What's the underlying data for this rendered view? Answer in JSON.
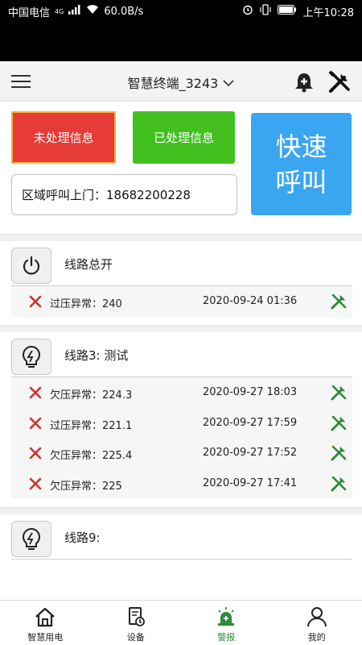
{
  "status_bar": {
    "carrier": "中国电信",
    "network": "4G",
    "speed": "60.0B/s",
    "battery": "100",
    "time": "上午10:28"
  },
  "header": {
    "title": "智慧终端_3243"
  },
  "actions": {
    "unhandled_label": "未处理信息",
    "handled_label": "已处理信息",
    "quick_call_line1": "快速",
    "quick_call_line2": "呼叫",
    "zone_call": "区域呼叫上门：18682200228"
  },
  "sections": [
    {
      "name": "线路总开",
      "icon": "power-icon",
      "rows": [
        {
          "msg": "过压异常：240",
          "time": "2020-09-24 01:36"
        }
      ]
    },
    {
      "name": "线路3: 测试",
      "icon": "bulb-icon",
      "rows": [
        {
          "msg": "欠压异常：224.3",
          "time": "2020-09-27 18:03"
        },
        {
          "msg": "过压异常：221.1",
          "time": "2020-09-27 17:59"
        },
        {
          "msg": "欠压异常：225.4",
          "time": "2020-09-27 17:52"
        },
        {
          "msg": "欠压异常：225",
          "time": "2020-09-27 17:41"
        }
      ]
    },
    {
      "name": "线路9:",
      "icon": "bulb-icon",
      "rows": []
    }
  ],
  "tabs": [
    {
      "label": "智慧用电",
      "icon": "home-icon"
    },
    {
      "label": "设备",
      "icon": "device-icon"
    },
    {
      "label": "警报",
      "icon": "alarm-icon",
      "active": true
    },
    {
      "label": "我的",
      "icon": "user-icon"
    }
  ],
  "colors": {
    "unhandled": "#e63b36",
    "handled": "#43c020",
    "quick_call": "#3aa6f2",
    "error_x": "#d0312d",
    "wrench": "#2e8b3a"
  }
}
